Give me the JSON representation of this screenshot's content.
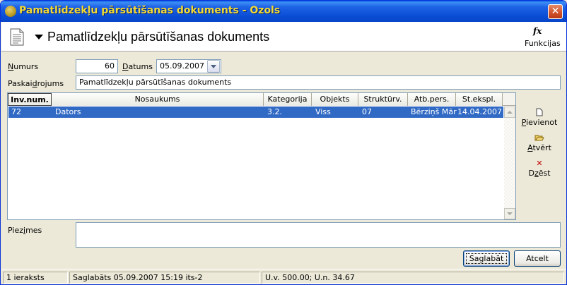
{
  "window": {
    "title": "Pamatlīdzekļu pārsūtīšanas dokuments - Ozols",
    "close_label": "✕"
  },
  "header": {
    "title": "Pamatlīdzekļu pārsūtīšanas dokuments",
    "functions_icon": "fx",
    "functions_label": "Funkcijas"
  },
  "form": {
    "number_label_u": "N",
    "number_label_rest": "umurs",
    "number_value": "60",
    "date_label_u": "D",
    "date_label_rest": "atums",
    "date_value": "05.09.2007",
    "explanation_label_pre": "Paskai",
    "explanation_label_u": "d",
    "explanation_label_post": "rojums",
    "explanation_value": "Pamatlīdzekļu pārsūtīšanas dokuments",
    "notes_label_pre": "Piez",
    "notes_label_u": "i",
    "notes_label_post": "mes",
    "notes_value": ""
  },
  "grid": {
    "columns": [
      "Inv.num.",
      "Nosaukums",
      "Kategorija",
      "Objekts",
      "Struktūrv.",
      "Atb.pers.",
      "St.ekspl."
    ],
    "rows": [
      [
        "72",
        "Dators",
        "3.2.",
        "Viss",
        "07",
        "Bērziņš Mārtiņš",
        "14.04.2007"
      ]
    ]
  },
  "side_buttons": {
    "add_u": "P",
    "add_rest": "ievienot",
    "open_u": "A",
    "open_rest": "tvērt",
    "delete_pre": "D",
    "delete_u": "z",
    "delete_post": "ēst"
  },
  "buttons": {
    "save": "Saglabāt",
    "cancel": "Atcelt"
  },
  "status": {
    "records": "1 ieraksts",
    "saved": "Saglabāts 05.09.2007 15:19 its-2",
    "user": "U.v. 500.00; U.n. 34.67"
  },
  "colors": {
    "selection": "#316AC5",
    "title_text": "#F4DA30",
    "titlebar": "#0B4FD6"
  }
}
